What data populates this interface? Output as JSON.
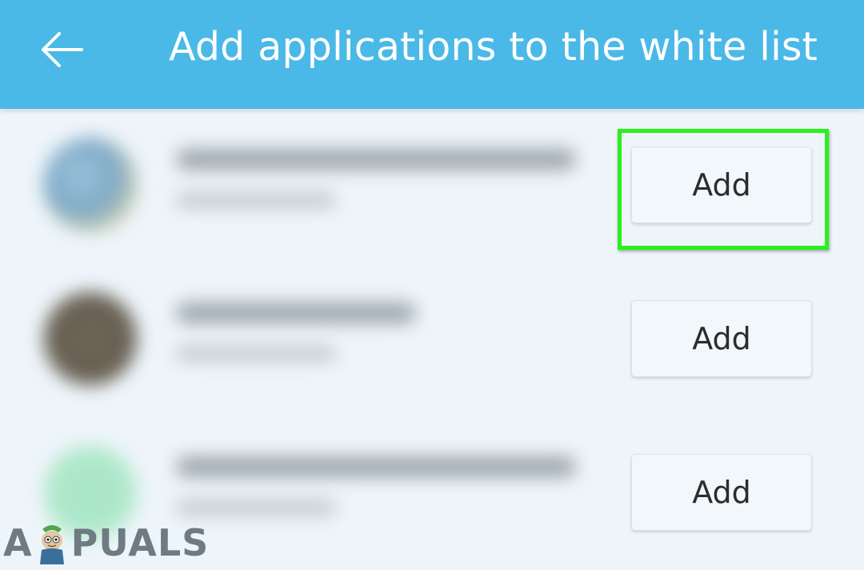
{
  "header": {
    "title": "Add applications to the white list",
    "back_icon": "arrow-left-icon",
    "background_color": "#4ab9e8"
  },
  "apps": [
    {
      "name": "",
      "size": "",
      "icon_color": "#8fb6cf",
      "add_label": "Add",
      "highlighted": true
    },
    {
      "name": "",
      "size": "",
      "icon_color": "#6f6656",
      "add_label": "Add",
      "highlighted": false
    },
    {
      "name": "",
      "size": "",
      "icon_color": "#a8e6c6",
      "add_label": "Add",
      "highlighted": false
    }
  ],
  "highlight": {
    "color": "#2bef1e"
  },
  "watermark": {
    "text_before": "A",
    "text_after": "PUALS"
  }
}
